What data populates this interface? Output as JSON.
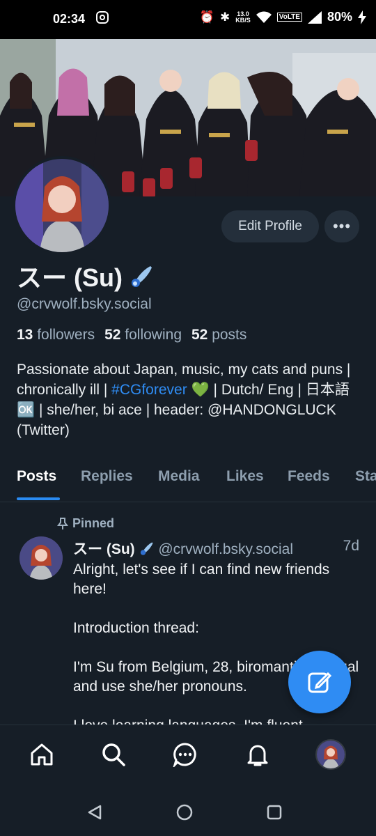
{
  "status_bar": {
    "time": "02:34",
    "net_speed_value": "13.0",
    "net_speed_unit": "KB/S",
    "battery": "80%"
  },
  "profile": {
    "display_name": "スー (Su)",
    "handle": "@crvwolf.bsky.social",
    "edit_label": "Edit Profile",
    "more_label": "•••",
    "stats": {
      "followers_count": "13",
      "followers_label": "followers",
      "following_count": "52",
      "following_label": "following",
      "posts_count": "52",
      "posts_label": "posts"
    },
    "bio_part1": "Passionate about Japan, music, my cats and puns | chronically ill | ",
    "bio_hashtag": "#CGforever",
    "bio_part2": " 💚 | Dutch/ Eng | 日本語 🆗 | she/her, bi ace | header: @HANDONGLUCK (Twitter)"
  },
  "tabs": [
    "Posts",
    "Replies",
    "Media",
    "Likes",
    "Feeds",
    "Sta"
  ],
  "post": {
    "pinned_label": "Pinned",
    "author_name": "スー (Su)",
    "author_handle": "@crvwolf.bsky.social",
    "time": "7d",
    "body": "Alright, let's see if I can find new friends here!\n\nIntroduction thread:\n\nI'm Su from Belgium, 28, biromantic asexual and use she/her pronouns.\n\nI love learning languages. I'm fluent"
  },
  "icons": {
    "fab": "compose-icon",
    "nav": [
      "home-icon",
      "search-icon",
      "chat-icon",
      "bell-icon",
      "avatar"
    ],
    "system": [
      "back-icon",
      "home-circle-icon",
      "recents-icon"
    ]
  },
  "colors": {
    "background": "#161e27",
    "accent": "#2f8cf3",
    "muted_text": "#9fb0c0"
  }
}
